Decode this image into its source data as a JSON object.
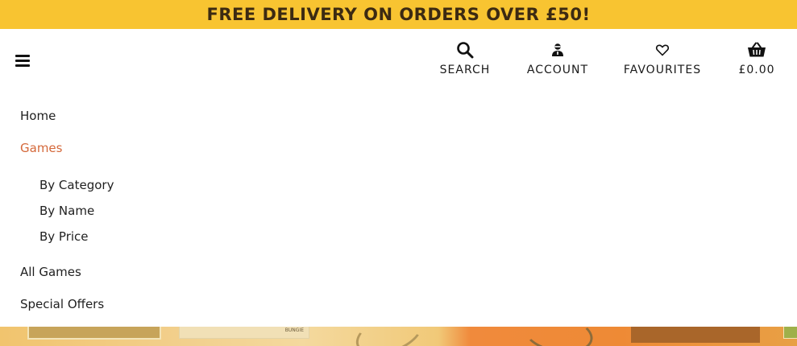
{
  "promo": {
    "text": "FREE DELIVERY ON ORDERS OVER £50!"
  },
  "header": {
    "menu_icon": "hamburger-icon",
    "actions": {
      "search": {
        "label": "SEARCH",
        "icon": "search-icon"
      },
      "account": {
        "label": "ACCOUNT",
        "icon": "user-icon"
      },
      "favourites": {
        "label": "FAVOURITES",
        "icon": "heart-icon"
      },
      "basket": {
        "label": "£0.00",
        "icon": "basket-icon"
      }
    }
  },
  "nav": {
    "items": [
      {
        "label": "Home",
        "active": false
      },
      {
        "label": "Games",
        "active": true,
        "children": [
          {
            "label": "By Category"
          },
          {
            "label": "By Name"
          },
          {
            "label": "By Price"
          }
        ]
      },
      {
        "label": "All Games",
        "active": false
      },
      {
        "label": "Special Offers",
        "active": false
      }
    ]
  },
  "hero": {
    "brand_text": "BUNGIE"
  },
  "colors": {
    "banner": "#f8c431",
    "active_link": "#d4683a",
    "text": "#1f1f1f"
  }
}
